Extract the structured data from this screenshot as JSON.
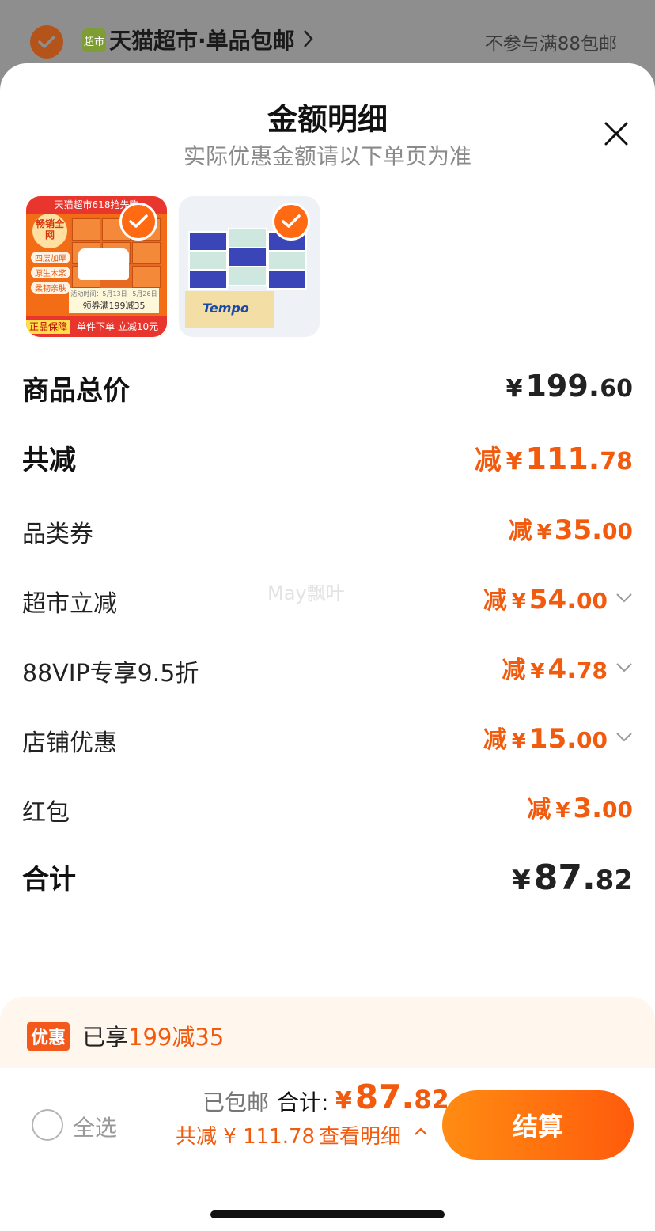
{
  "store": {
    "logo_text": "超市",
    "name": "天猫超市·单品包邮",
    "note": "不参与满88包邮"
  },
  "sheet": {
    "title": "金额明细",
    "subtitle": "实际优惠金额请以下单页为准"
  },
  "products": [
    {
      "banner": "天猫超市618抢先购",
      "hot": "畅销全网",
      "tags": [
        "四层加厚",
        "原生木浆",
        "柔韧亲肤"
      ],
      "promo": "领券满199减35",
      "promo_sub": "活动时间：5月13日~5月26日",
      "foot_left": "正品保障",
      "foot_right": "单件下单 立减10元"
    },
    {
      "brand": "Tempo"
    }
  ],
  "rows": {
    "subtotal": {
      "label": "商品总价",
      "yen": "¥",
      "int": "199.",
      "dec": "60"
    },
    "total_reduce": {
      "label": "共减",
      "prefix": "减",
      "yen": "¥",
      "int": "111.",
      "dec": "78"
    },
    "category_coupon": {
      "label": "品类券",
      "prefix": "减",
      "yen": "¥",
      "int": "35.",
      "dec": "00"
    },
    "market_discount": {
      "label": "超市立减",
      "prefix": "减",
      "yen": "¥",
      "int": "54.",
      "dec": "00"
    },
    "vip": {
      "label": "88VIP专享9.5折",
      "prefix": "减",
      "yen": "¥",
      "int": "4.",
      "dec": "78"
    },
    "shop": {
      "label": "店铺优惠",
      "prefix": "减",
      "yen": "¥",
      "int": "15.",
      "dec": "00"
    },
    "red_packet": {
      "label": "红包",
      "prefix": "减",
      "yen": "¥",
      "int": "3.",
      "dec": "00"
    },
    "grand_total": {
      "label": "合计",
      "yen": "¥",
      "int": "87.",
      "dec": "82"
    }
  },
  "watermark": "May飘叶",
  "promo_bar": {
    "badge": "优惠",
    "text_prefix": "已享",
    "text_highlight": "199减35"
  },
  "bottom": {
    "select_all": "全选",
    "shipping": "已包邮",
    "total_label": "合计:",
    "total_yen": "¥",
    "total_int": "87.",
    "total_dec": "82",
    "saved": "共减 ¥ 111.78",
    "details": "查看明细",
    "checkout": "结算"
  },
  "colors": {
    "accent": "#f25a0d",
    "checkout_start": "#ff8c12",
    "checkout_end": "#ff5b0c"
  }
}
